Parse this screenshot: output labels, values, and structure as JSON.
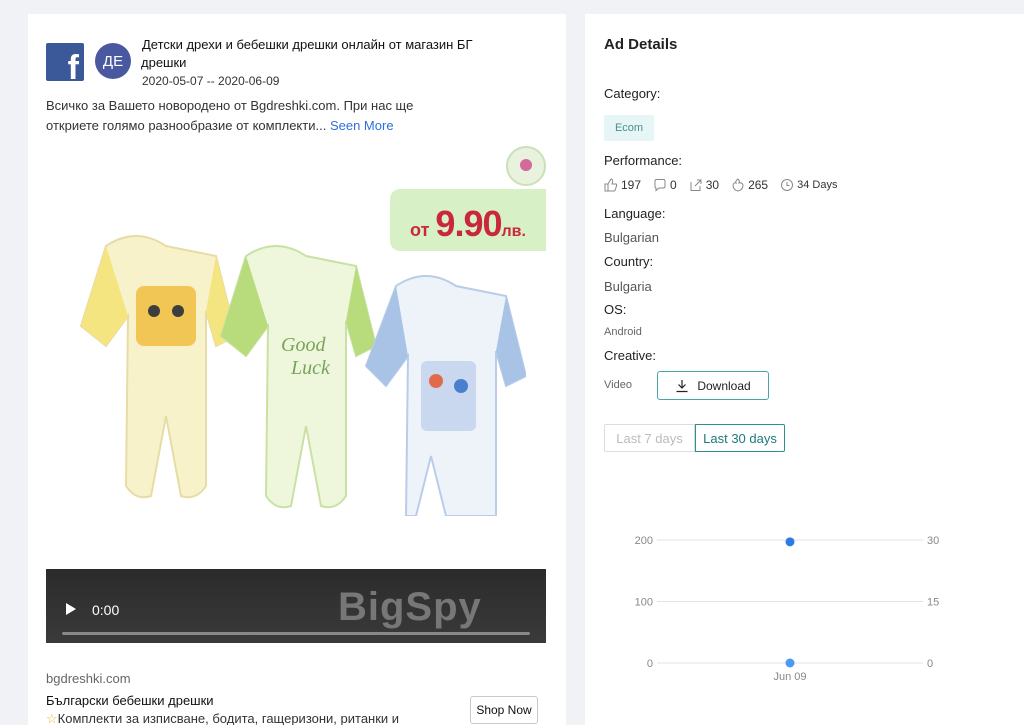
{
  "ad": {
    "platform_icon": "facebook-icon",
    "avatar_text": "ДЕ",
    "title_line1": "Детски дрехи и бебешки дрешки онлайн от магазин БГ",
    "title_line2": "дрешки",
    "date_range": "2020-05-07 -- 2020-06-09",
    "text_line1": "Всичко за Вашето новородено от Bgdreshki.com. При нас ще",
    "text_line2": "откриете голямо разнообразие от комплекти...",
    "see_more": "Seen More",
    "price_prefix": "от",
    "price_value": "9.90",
    "price_currency": "лв.",
    "watermark": "BigSpy",
    "video_time": "0:00",
    "video_progress": 0,
    "domain": "bgdreshki.com",
    "product_name": "Български бебешки дрешки",
    "description": "Комплекти за изписване, бодита, гащеризони, ританки и",
    "cta": "Shop Now"
  },
  "details": {
    "title": "Ad Details",
    "category_label": "Category:",
    "category_value": "Ecom",
    "performance_label": "Performance:",
    "likes": "197",
    "comments": "0",
    "shares": "30",
    "reactions": "265",
    "duration": "34 Days",
    "language_label": "Language:",
    "language_value": "Bulgarian",
    "country_label": "Country:",
    "country_value": "Bulgaria",
    "os_label": "OS:",
    "os_value": "Android",
    "creative_label": "Creative:",
    "creative_type": "Video",
    "download_label": "Download",
    "range_7": "Last 7 days",
    "range_30": "Last 30 days",
    "selected_range": "Last 30 days"
  },
  "colors": {
    "facebook": "#3b5998",
    "accent": "#2a9090",
    "link": "#2f6fdd",
    "chart_point": "#2d7be5"
  },
  "chart_data": {
    "type": "line",
    "x": [
      "Jun 09"
    ],
    "left_ticks": [
      "200",
      "100",
      "0"
    ],
    "right_ticks": [
      "30",
      "15",
      "0"
    ],
    "left_ylim": [
      0,
      200
    ],
    "right_ylim": [
      0,
      30
    ],
    "series": [
      {
        "axis": "left",
        "values": [
          197
        ]
      },
      {
        "axis": "right",
        "values": [
          0
        ]
      }
    ],
    "grid": true
  }
}
